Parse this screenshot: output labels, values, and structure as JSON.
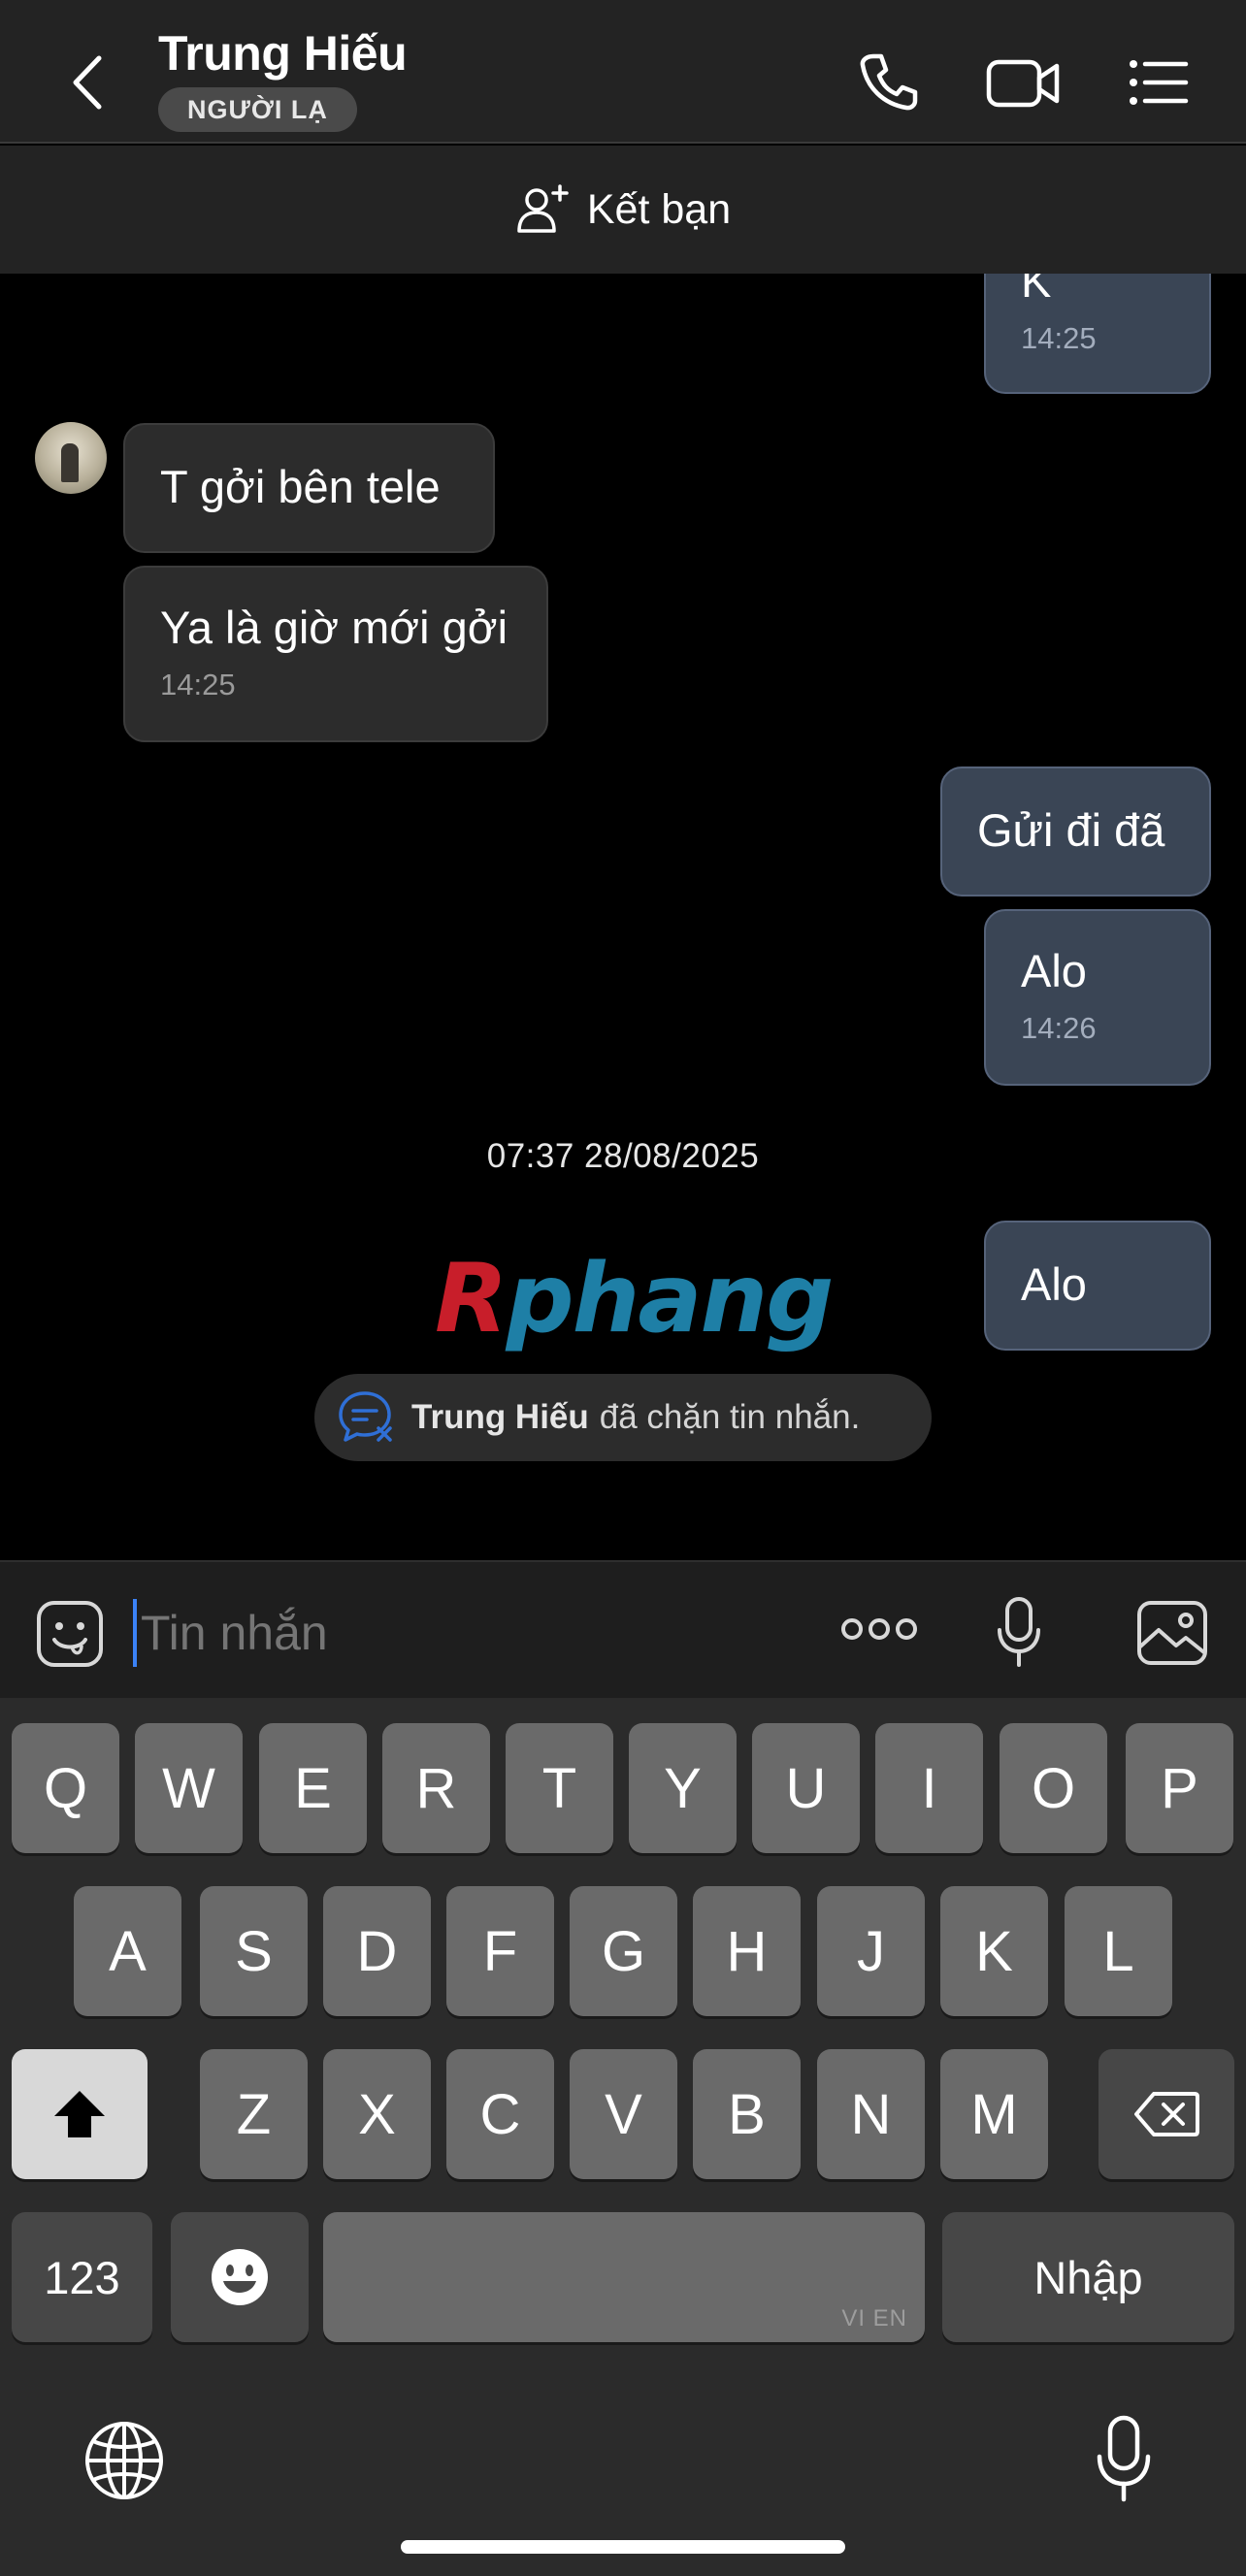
{
  "header": {
    "title": "Trung Hiếu",
    "badge": "NGƯỜI LẠ"
  },
  "friend_bar": {
    "label": "Kết bạn"
  },
  "messages": [
    {
      "side": "out",
      "text": "K",
      "time": "14:25"
    },
    {
      "side": "in",
      "text": "T gởi bên tele",
      "time": ""
    },
    {
      "side": "in",
      "text": "Ya là giờ mới gởi",
      "time": "14:25"
    },
    {
      "side": "out",
      "text": "Gửi đi đã",
      "time": ""
    },
    {
      "side": "out",
      "text": "Alo",
      "time": "14:26"
    },
    {
      "side": "out",
      "text": "Alo",
      "time": ""
    }
  ],
  "date_separator": "07:37 28/08/2025",
  "watermark": {
    "first": "R",
    "rest": "phang"
  },
  "blocked_notice": {
    "name": "Trung Hiếu",
    "text": "đã chặn tin nhắn."
  },
  "composer": {
    "placeholder": "Tin nhắn"
  },
  "keyboard": {
    "row1": [
      "Q",
      "W",
      "E",
      "R",
      "T",
      "Y",
      "U",
      "I",
      "O",
      "P"
    ],
    "row2": [
      "A",
      "S",
      "D",
      "F",
      "G",
      "H",
      "J",
      "K",
      "L"
    ],
    "row3": [
      "Z",
      "X",
      "C",
      "V",
      "B",
      "N",
      "M"
    ],
    "numbers_key": "123",
    "return_key": "Nhập",
    "language_tag": "VI EN"
  },
  "icons": {
    "back": "chevron-left-icon",
    "call": "phone-icon",
    "video": "video-camera-icon",
    "menu": "list-menu-icon",
    "add_friend": "add-person-icon",
    "emoji": "emoji-icon",
    "more": "more-icon",
    "mic": "microphone-icon",
    "image": "image-icon",
    "blocked": "blocked-chat-icon",
    "shift": "shift-icon",
    "delete": "backspace-icon",
    "globe": "globe-icon",
    "dictation": "dictation-mic-icon"
  },
  "colors": {
    "outgoing_bubble": "#3a4555",
    "incoming_bubble": "#2c2c2c",
    "header_bg": "#232323",
    "cursor": "#3b82f6"
  }
}
